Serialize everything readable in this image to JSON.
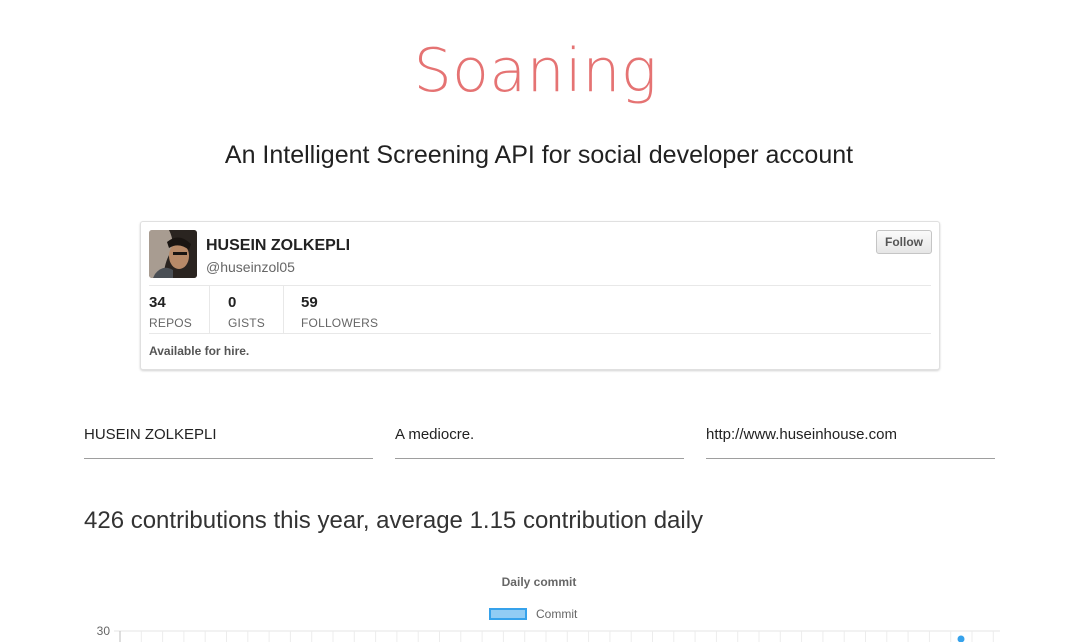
{
  "brand": "Soaning",
  "tagline": "An Intelligent Screening API for social developer account",
  "profile_card": {
    "name": "HUSEIN ZOLKEPLI",
    "handle": "@huseinzol05",
    "follow_label": "Follow",
    "stats": [
      {
        "value": "34",
        "label": "REPOS"
      },
      {
        "value": "0",
        "label": "GISTS"
      },
      {
        "value": "59",
        "label": "FOLLOWERS"
      }
    ],
    "footer": "Available for hire."
  },
  "fields": {
    "name": "HUSEIN ZOLKEPLI",
    "bio": "A mediocre.",
    "website": "http://www.huseinhouse.com"
  },
  "contributions_summary": "426 contributions this year, average 1.15 contribution daily",
  "chart_data": {
    "type": "line",
    "title": "Daily commit",
    "series": [
      {
        "name": "Commit",
        "color": "#36a2eb"
      }
    ],
    "y_tick_visible": "30",
    "grid": true,
    "legend": "top"
  }
}
